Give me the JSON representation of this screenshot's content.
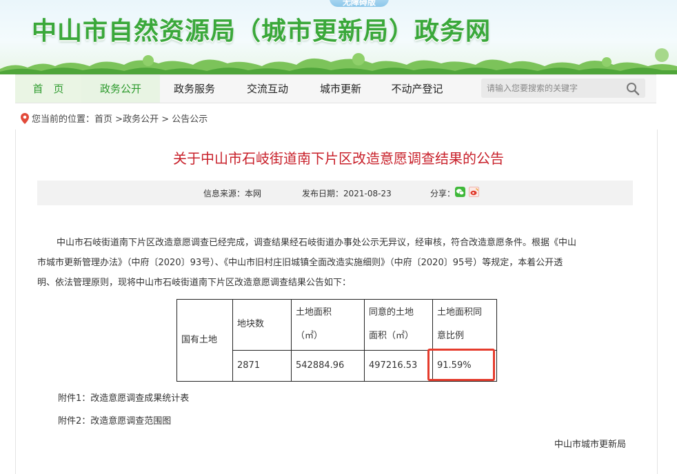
{
  "banner": {
    "accessible_label": "无障碍版",
    "site_title": "中山市自然资源局（城市更新局）政务网"
  },
  "nav": {
    "items": [
      {
        "label": "首　页"
      },
      {
        "label": "政务公开"
      },
      {
        "label": "政务服务"
      },
      {
        "label": "交流互动"
      },
      {
        "label": "城市更新"
      },
      {
        "label": "不动产登记"
      }
    ],
    "search_placeholder": "请输入您要搜索的关键字"
  },
  "breadcrumb": {
    "prefix": "您当前的位置：",
    "home": "首页",
    "sep1": " >",
    "section": "政务公开",
    "sep2": " > ",
    "page": "公告公示"
  },
  "article": {
    "title": "关于中山市石岐街道南下片区改造意愿调查结果的公告",
    "source_label": "信息来源：本网",
    "date_label": "发布日期：2021-08-23",
    "share_label": "分享：",
    "paragraph_lines": [
      "中山市石岐街道南下片区改造意愿调查已经完成，调查结果经石岐街道办事处公示无异议，经审核，符合改造意愿条件。根据《中山",
      "市城市更新管理办法》（中府〔2020〕93号）、《中山市旧村庄旧城镇全面改造实施细则》（中府〔2020〕95号）等规定，本着公开透",
      "明、依法管理原则，现将中山市石岐街道南下片区改造意愿调查结果公告如下："
    ],
    "table": {
      "row_header": "国有土地",
      "col1_header": "地块数",
      "col2_header_line1": "土地面积",
      "col2_header_line2": "（㎡）",
      "col3_header_line1": "同意的土地",
      "col3_header_line2": "面积（㎡）",
      "col4_header_line1": "土地面积同",
      "col4_header_line2": "意比例",
      "parcels": "2871",
      "land_area": "542884.96",
      "agreed_area": "497216.53",
      "agreed_ratio": "91.59%"
    },
    "attachments": [
      "附件1：改造意愿调查成果统计表",
      "附件2：改造意愿调查范围图"
    ],
    "signature": "中山市城市更新局"
  },
  "colors": {
    "brand_green": "#3aa83a",
    "title_red": "#c8202a",
    "highlight_red": "#e53b2c"
  },
  "icons": [
    "location-pin-icon",
    "search-icon",
    "wechat-share-icon",
    "weibo-share-icon"
  ]
}
